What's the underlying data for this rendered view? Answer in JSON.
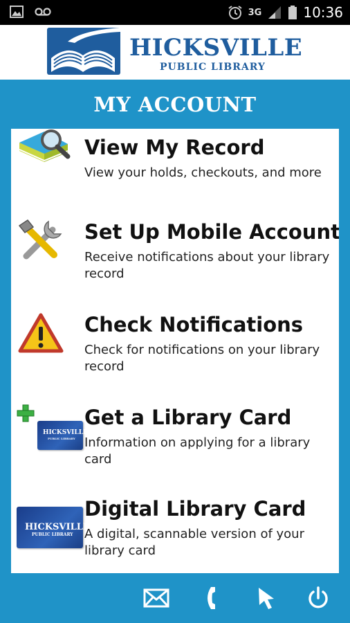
{
  "status_bar": {
    "time": "10:36",
    "network": "3G",
    "icons": [
      "picture-icon",
      "voicemail-icon",
      "alarm-icon",
      "signal-icon",
      "battery-icon"
    ]
  },
  "header": {
    "logo_title": "HICKSVILLE",
    "logo_subtitle": "PUBLIC LIBRARY"
  },
  "page": {
    "title": "MY ACCOUNT"
  },
  "menu": [
    {
      "title": "View My Record",
      "description": "View your holds, checkouts, and more",
      "icon": "book-magnifier-icon"
    },
    {
      "title": "Set Up Mobile Account",
      "description": "Receive notifications about your library record",
      "icon": "tools-icon"
    },
    {
      "title": "Check Notifications",
      "description": "Check for notifications on your library record",
      "icon": "warning-icon"
    },
    {
      "title": "Get a Library Card",
      "description": "Information on applying for a library card",
      "icon": "add-library-card-icon"
    },
    {
      "title": "Digital Library Card",
      "description": "A digital, scannable version of your library card",
      "icon": "digital-library-card-icon"
    }
  ],
  "card_icon_text": {
    "title": "HICKSVILLE",
    "subtitle": "PUBLIC LIBRARY"
  },
  "bottom_bar": {
    "buttons": [
      "email-icon",
      "phone-icon",
      "pointer-icon",
      "power-icon"
    ]
  },
  "colors": {
    "accent": "#1f93c8",
    "brand": "#1f5d9e",
    "status_bar": "#000000"
  }
}
